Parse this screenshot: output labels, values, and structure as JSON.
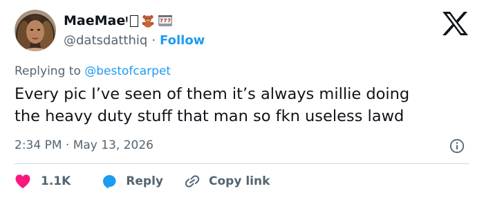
{
  "author": {
    "display_name": "MaeMaeᵎ",
    "handle": "@datsdatthiq",
    "follow_label": "Follow",
    "separator": "·",
    "name_emojis": [
      "missing-glyph-box",
      "teddy-bear-icon",
      "slot-machine-icon"
    ]
  },
  "reply_context": {
    "prefix": "Replying to ",
    "mention": "@bestofcarpet"
  },
  "tweet": {
    "text": "Every pic I’ve seen of them it’s always millie doing\nthe heavy duty stuff that man so fkn useless lawd",
    "timestamp": "2:34 PM · May 13, 2026"
  },
  "actions": {
    "like_count": "1.1K",
    "reply_label": "Reply",
    "copy_link_label": "Copy link"
  },
  "colors": {
    "accent": "#1d9bf0",
    "like": "#f91880",
    "text": "#0f1419",
    "muted": "#536471",
    "divider": "#cfd9de"
  },
  "icons": {
    "platform_logo": "x-logo-icon",
    "info": "info-icon",
    "like": "heart-icon",
    "reply": "speech-bubble-icon",
    "copy_link": "link-icon"
  }
}
